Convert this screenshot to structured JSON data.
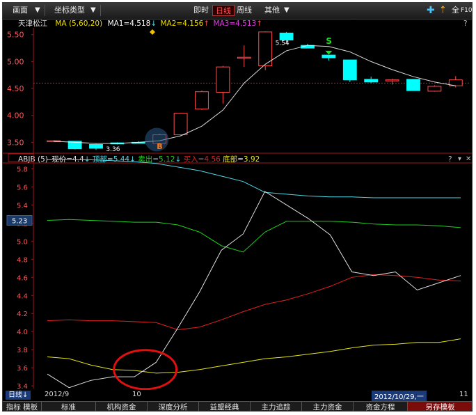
{
  "toolbar": {
    "screen_label": "画面",
    "coord_label": "坐标类型",
    "btn_realtime": "即时",
    "btn_daily": "日线",
    "btn_weekly": "周线",
    "btn_other": "其他",
    "btn_full": "全",
    "btn_f10": "F10"
  },
  "main_info": {
    "stock_name": "天津松江",
    "ma_label": "MA",
    "ma_params": "(5,60,20)",
    "ma1": "MA1=4.518",
    "ma2": "MA2=4.156",
    "ma3": "MA3=4.513",
    "help": "?"
  },
  "main_axis": [
    "5.50",
    "5.00",
    "4.50",
    "4.00",
    "3.50"
  ],
  "main_annotations": {
    "s_marker": "S",
    "b_marker": "B",
    "low_label": "3.36",
    "high_label": "5.54"
  },
  "ind_info": {
    "name": "ABJB",
    "param": "(5)",
    "price": "现价=4.4",
    "top": "顶部=5.44",
    "sell": "卖出=5.12",
    "buy": "买入=4.56",
    "bottom": "底部=3.92",
    "help": "?",
    "arrow": "↓"
  },
  "ind_axis": [
    "5.8",
    "5.6",
    "5.4",
    "5.2",
    "5.0",
    "4.8",
    "4.6",
    "4.4",
    "4.2",
    "4.0",
    "3.8",
    "3.6",
    "3.4"
  ],
  "ind_current": "5.23",
  "time_axis": {
    "period": "日线",
    "start": "2012/9",
    "mid": "10",
    "cursor": "2012/10/29,一",
    "end": "11"
  },
  "tabs": [
    {
      "label": "指标 模板"
    },
    {
      "label": "标准"
    },
    {
      "label": "机构资金"
    },
    {
      "label": "深度分析"
    },
    {
      "label": "益盟经典"
    },
    {
      "label": "主力追踪"
    },
    {
      "label": "主力资金"
    },
    {
      "label": "资金方程"
    },
    {
      "label": "另存模板"
    }
  ],
  "colors": {
    "up": "#ff4d4d",
    "down": "#00ffff",
    "ma": "#ffffff",
    "top": "#4fd8e6",
    "sell": "#1fcf1f",
    "buy": "#e02020",
    "bottom": "#e6e61a",
    "price": "#e0e0e0"
  },
  "chart_data": [
    {
      "type": "candlestick",
      "ylim": [
        3.35,
        5.6
      ],
      "candles": [
        {
          "o": 3.53,
          "c": 3.53,
          "h": 3.54,
          "l": 3.52
        },
        {
          "o": 3.52,
          "c": 3.38,
          "h": 3.52,
          "l": 3.37
        },
        {
          "o": 3.46,
          "c": 3.39,
          "h": 3.47,
          "l": 3.36
        },
        {
          "o": 3.49,
          "c": 3.48,
          "h": 3.5,
          "l": 3.46
        },
        {
          "o": 3.5,
          "c": 3.49,
          "h": 3.52,
          "l": 3.48
        },
        {
          "o": 3.48,
          "c": 3.64,
          "h": 3.66,
          "l": 3.45
        },
        {
          "o": 3.64,
          "c": 4.04,
          "h": 4.05,
          "l": 3.63
        },
        {
          "o": 4.12,
          "c": 4.44,
          "h": 4.46,
          "l": 4.1
        },
        {
          "o": 4.43,
          "c": 4.9,
          "h": 4.92,
          "l": 4.22
        },
        {
          "o": 5.08,
          "c": 5.08,
          "h": 5.3,
          "l": 4.9
        },
        {
          "o": 4.92,
          "c": 5.55,
          "h": 5.56,
          "l": 4.84
        },
        {
          "o": 5.53,
          "c": 5.4,
          "h": 5.55,
          "l": 5.35
        },
        {
          "o": 5.3,
          "c": 5.25,
          "h": 5.33,
          "l": 5.25
        },
        {
          "o": 5.12,
          "c": 5.07,
          "h": 5.12,
          "l": 5.02
        },
        {
          "o": 5.03,
          "c": 4.66,
          "h": 5.03,
          "l": 4.62
        },
        {
          "o": 4.67,
          "c": 4.62,
          "h": 4.72,
          "l": 4.6
        },
        {
          "o": 4.65,
          "c": 4.66,
          "h": 4.68,
          "l": 4.57
        },
        {
          "o": 4.67,
          "c": 4.46,
          "h": 4.67,
          "l": 4.46
        },
        {
          "o": 4.45,
          "c": 4.54,
          "h": 4.56,
          "l": 4.44
        },
        {
          "o": 4.55,
          "c": 4.66,
          "h": 4.73,
          "l": 4.52
        }
      ],
      "ma_line": [
        3.52,
        3.5,
        3.48,
        3.48,
        3.5,
        3.53,
        3.62,
        3.8,
        4.1,
        4.6,
        4.95,
        5.2,
        5.3,
        5.28,
        5.18,
        5.0,
        4.85,
        4.72,
        4.62,
        4.55
      ]
    },
    {
      "type": "line",
      "ylim": [
        3.37,
        5.85
      ],
      "x": [
        0,
        1,
        2,
        3,
        4,
        5,
        6,
        7,
        8,
        9,
        10,
        11,
        12,
        13,
        14,
        15,
        16,
        17,
        18,
        19
      ],
      "series": [
        {
          "name": "顶部",
          "values": [
            5.9,
            5.9,
            5.9,
            5.89,
            5.88,
            5.86,
            5.82,
            5.78,
            5.72,
            5.66,
            5.54,
            5.52,
            5.5,
            5.49,
            5.49,
            5.48,
            5.48,
            5.48,
            5.48,
            5.48
          ]
        },
        {
          "name": "卖出",
          "values": [
            5.23,
            5.24,
            5.23,
            5.22,
            5.21,
            5.21,
            5.18,
            5.1,
            4.95,
            4.88,
            5.1,
            5.22,
            5.22,
            5.22,
            5.21,
            5.19,
            5.18,
            5.18,
            5.17,
            5.15
          ]
        },
        {
          "name": "买入",
          "values": [
            4.12,
            4.13,
            4.12,
            4.12,
            4.11,
            4.1,
            4.02,
            4.05,
            4.13,
            4.22,
            4.3,
            4.35,
            4.42,
            4.5,
            4.6,
            4.63,
            4.62,
            4.6,
            4.57,
            4.56
          ]
        },
        {
          "name": "底部",
          "values": [
            3.72,
            3.7,
            3.63,
            3.58,
            3.57,
            3.54,
            3.55,
            3.58,
            3.62,
            3.66,
            3.7,
            3.72,
            3.75,
            3.78,
            3.82,
            3.85,
            3.86,
            3.88,
            3.88,
            3.92
          ]
        },
        {
          "name": "现价",
          "values": [
            3.53,
            3.38,
            3.46,
            3.5,
            3.5,
            3.66,
            4.04,
            4.44,
            4.9,
            5.08,
            5.55,
            5.4,
            5.25,
            5.07,
            4.66,
            4.62,
            4.66,
            4.46,
            4.54,
            4.62
          ]
        }
      ]
    }
  ]
}
